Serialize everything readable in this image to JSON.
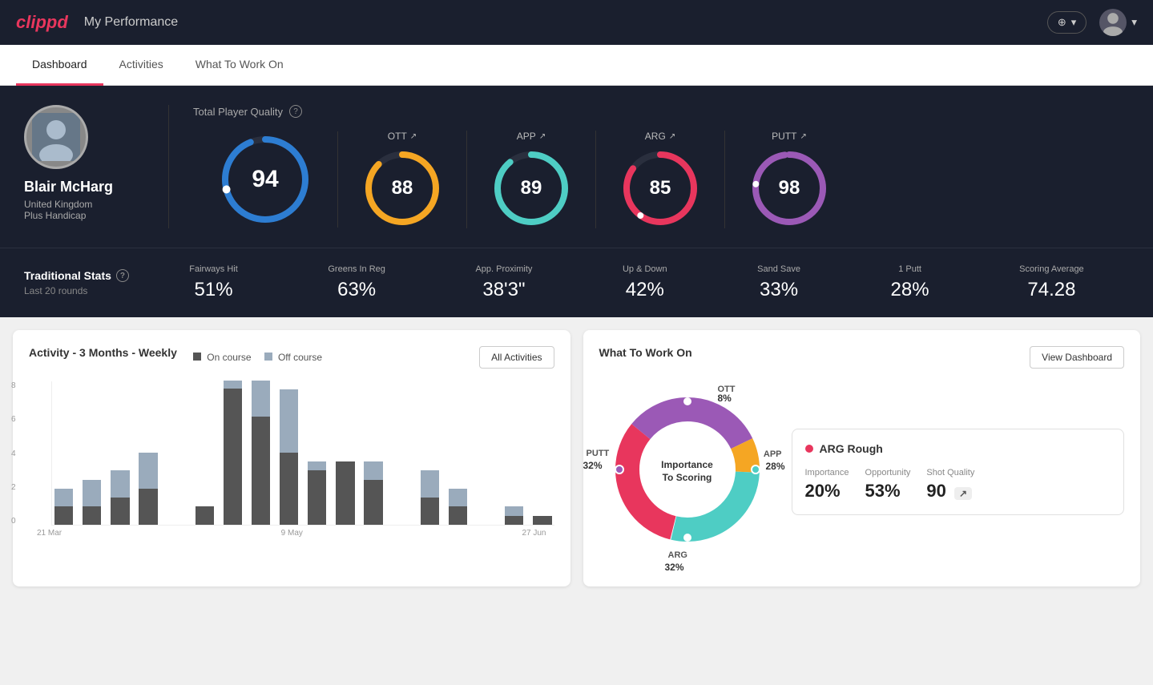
{
  "header": {
    "logo": "clippd",
    "title": "My Performance",
    "add_button_label": "+ ▾",
    "avatar_chevron": "▾"
  },
  "nav": {
    "tabs": [
      {
        "id": "dashboard",
        "label": "Dashboard",
        "active": true
      },
      {
        "id": "activities",
        "label": "Activities",
        "active": false
      },
      {
        "id": "what-to-work-on",
        "label": "What To Work On",
        "active": false
      }
    ]
  },
  "player": {
    "name": "Blair McHarg",
    "country": "United Kingdom",
    "handicap": "Plus Handicap"
  },
  "total_quality": {
    "label": "Total Player Quality",
    "value": 94,
    "color": "#2d7dd2",
    "percent": 94
  },
  "scores": [
    {
      "id": "ott",
      "label": "OTT",
      "value": 88,
      "color": "#f5a623",
      "percent": 88
    },
    {
      "id": "app",
      "label": "APP",
      "value": 89,
      "color": "#4ecdc4",
      "percent": 89
    },
    {
      "id": "arg",
      "label": "ARG",
      "value": 85,
      "color": "#e8365d",
      "percent": 85
    },
    {
      "id": "putt",
      "label": "PUTT",
      "value": 98,
      "color": "#9b59b6",
      "percent": 98
    }
  ],
  "trad_stats": {
    "label": "Traditional Stats",
    "sub_label": "Last 20 rounds",
    "stats": [
      {
        "name": "Fairways Hit",
        "value": "51%"
      },
      {
        "name": "Greens In Reg",
        "value": "63%"
      },
      {
        "name": "App. Proximity",
        "value": "38'3\""
      },
      {
        "name": "Up & Down",
        "value": "42%"
      },
      {
        "name": "Sand Save",
        "value": "33%"
      },
      {
        "name": "1 Putt",
        "value": "28%"
      },
      {
        "name": "Scoring Average",
        "value": "74.28"
      }
    ]
  },
  "activity_chart": {
    "title": "Activity - 3 Months - Weekly",
    "legend": [
      {
        "label": "On course",
        "color": "#555"
      },
      {
        "label": "Off course",
        "color": "#9aabbc"
      }
    ],
    "button": "All Activities",
    "x_labels": [
      "21 Mar",
      "9 May",
      "27 Jun"
    ],
    "y_labels": [
      "8",
      "6",
      "4",
      "2",
      "0"
    ],
    "bars": [
      {
        "on": 1,
        "off": 1
      },
      {
        "on": 1,
        "off": 1.5
      },
      {
        "on": 1.5,
        "off": 1.5
      },
      {
        "on": 2,
        "off": 2
      },
      {
        "on": 0,
        "off": 0
      },
      {
        "on": 1,
        "off": 0
      },
      {
        "on": 8,
        "off": 0.5
      },
      {
        "on": 6,
        "off": 2
      },
      {
        "on": 4,
        "off": 3.5
      },
      {
        "on": 3,
        "off": 0.5
      },
      {
        "on": 3.5,
        "off": 0
      },
      {
        "on": 2.5,
        "off": 1
      },
      {
        "on": 0,
        "off": 0
      },
      {
        "on": 1.5,
        "off": 1.5
      },
      {
        "on": 1,
        "off": 1
      },
      {
        "on": 0,
        "off": 0
      },
      {
        "on": 0.5,
        "off": 0.5
      },
      {
        "on": 0.5,
        "off": 0
      }
    ]
  },
  "what_to_work_on": {
    "title": "What To Work On",
    "button": "View Dashboard",
    "center_text": "Importance\nTo Scoring",
    "segments": [
      {
        "id": "ott",
        "label": "OTT",
        "value": "8%",
        "color": "#f5a623",
        "angle_start": 0,
        "angle_end": 29
      },
      {
        "id": "app",
        "label": "APP",
        "value": "28%",
        "color": "#4ecdc4",
        "angle_start": 29,
        "angle_end": 130
      },
      {
        "id": "arg",
        "label": "ARG",
        "value": "32%",
        "color": "#e8365d",
        "angle_start": 130,
        "angle_end": 245
      },
      {
        "id": "putt",
        "label": "PUTT",
        "value": "32%",
        "color": "#9b59b6",
        "angle_start": 245,
        "angle_end": 360
      }
    ],
    "detail_card": {
      "title": "ARG Rough",
      "dot_color": "#e8365d",
      "metrics": [
        {
          "name": "Importance",
          "value": "20%"
        },
        {
          "name": "Opportunity",
          "value": "53%"
        },
        {
          "name": "Shot Quality",
          "value": "90",
          "badge": "↗"
        }
      ]
    }
  }
}
